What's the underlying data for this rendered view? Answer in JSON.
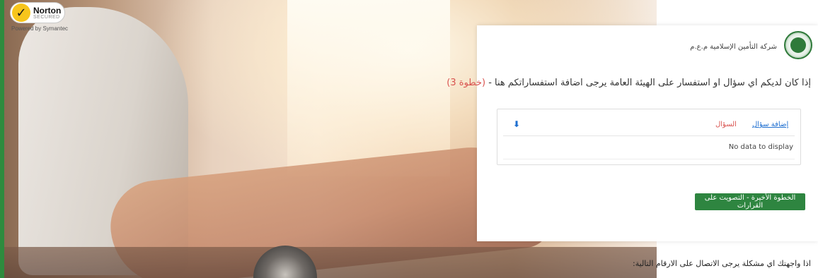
{
  "norton": {
    "brand": "Norton",
    "secured": "SECURED",
    "check": "✓",
    "powered_by": "Powered by Symantec"
  },
  "card": {
    "company_name": "شركة التأمين الإسلامية م.ع.م",
    "question_text": "إذا كان لديكم اي سؤال او استفسار على الهيئة العامة يرجى اضافة استفساراتكم هنا - ",
    "step_label": "(خطوة 3)",
    "grid": {
      "sort_icon": "⬇",
      "col_question": "السؤال",
      "col_add": "إضافة سؤال",
      "empty_text": "No data to display"
    },
    "vote_button": "الخطوة الأخيرة - التصويت على القرارات"
  },
  "contact_text": "اذا واجهتك اي مشكلة يرجى الاتصال على الارقام التالية:",
  "colors": {
    "accent_green": "#2e8540",
    "link_blue": "#1f6fd0",
    "step_red": "#d9534f"
  }
}
